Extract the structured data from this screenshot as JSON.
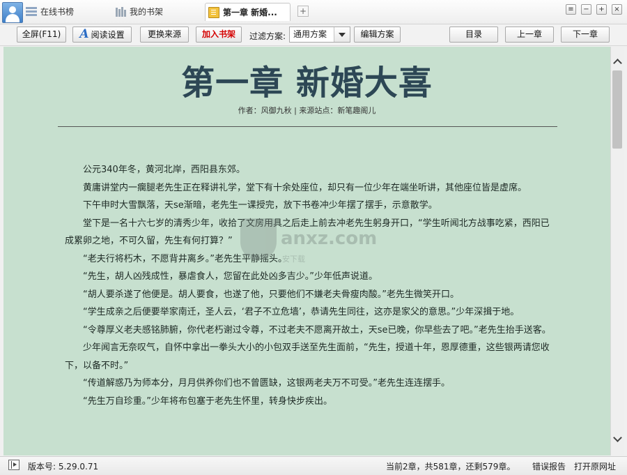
{
  "tabs": [
    {
      "label": "在线书榜",
      "icon": "list-icon"
    },
    {
      "label": "我的书架",
      "icon": "bookshelf-icon"
    },
    {
      "label": "第一章 新婚...",
      "icon": "book-icon",
      "active": true
    }
  ],
  "window": {
    "new_tab": "+"
  },
  "toolbar": {
    "fullscreen": "全屏(F11)",
    "read_settings": "阅读设置",
    "change_source": "更换来源",
    "add_shelf": "加入书架",
    "filter_label": "过滤方案:",
    "filter_value": "通用方案",
    "edit_scheme": "编辑方案",
    "toc": "目录",
    "prev": "上一章",
    "next": "下一章"
  },
  "chapter": {
    "title": "第一章 新婚大喜",
    "meta": "作者：风御九秋 | 来源站点：新笔趣阁儿",
    "paragraphs": [
      "公元340年冬，黄河北岸，西阳县东郊。",
      "黄庸讲堂内一瘸腿老先生正在释讲礼学，堂下有十余处座位，却只有一位少年在端坐听讲，其他座位皆是虚席。",
      "下午申时大雪飘落，天se渐暗，老先生一课授完，放下书卷冲少年摆了摆手，示意散学。",
      "堂下是一名十六七岁的清秀少年，收拾了文房用具之后走上前去冲老先生躬身开口，“学生听闻北方战事吃紧，西阳已成累卵之地，不可久留，先生有何打算？”",
      "“老夫行将朽木，不愿背井离乡。”老先生平静摇头。",
      "“先生，胡人凶残成性，暴虐食人，您留在此处凶多吉少。”少年低声说道。",
      "“胡人要杀遂了他便是。胡人要食，也遂了他，只要他们不嫌老夫骨瘦肉酸。”老先生微笑开口。",
      "“学生成亲之后便要举家南迁，圣人云，‘君子不立危墙’，恭请先生同往，这亦是家父的意思。”少年深揖于地。",
      "“令尊厚义老夫感铭肺腑，你代老朽谢过令尊，不过老夫不愿离开故土，天se已晚，你早些去了吧。”老先生抬手送客。",
      "少年闻言无奈叹气，自怀中拿出一拳头大小的小包双手送至先生面前，“先生，授道十年，恩厚德重，这些银两请您收下，以备不时。”",
      "“传道解惑乃为师本分，月月供养你们也不曾匮缺，这银两老夫万不可受。”老先生连连摆手。",
      "“先生万自珍重。”少年将布包塞于老先生怀里，转身快步疾出。"
    ]
  },
  "watermark": {
    "text": "anxz.com",
    "sub": "安下载"
  },
  "status": {
    "version": "版本号: 5.29.0.71",
    "progress": "当前2章，共581章，还剩579章。",
    "report": "错误报告",
    "open_url": "打开原网址"
  },
  "scroll": {
    "position_fraction": 0.0
  }
}
